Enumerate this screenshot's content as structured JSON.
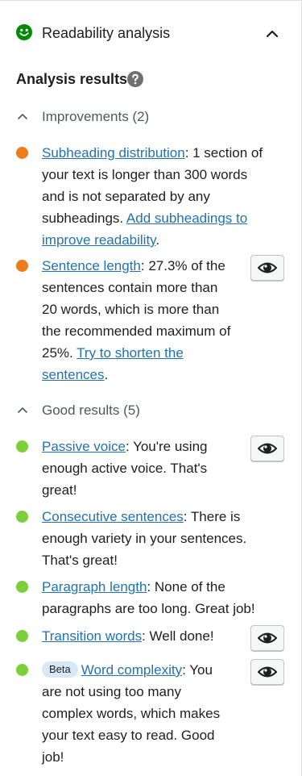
{
  "panel": {
    "title": "Readability analysis"
  },
  "analysis": {
    "title": "Analysis results"
  },
  "groups": {
    "improvements": {
      "label": "Improvements (2)",
      "items": [
        {
          "link": "Subheading distribution",
          "text": ": 1 section of your text is longer than 300 words and is not separated by any subheadings. ",
          "cta": "Add subheadings to improve readability",
          "end": "."
        },
        {
          "link": "Sentence length",
          "text": ": 27.3% of the sentences contain more than 20 words, which is more than the recommended maximum of 25%. ",
          "cta": "Try to shorten the sentences",
          "end": "."
        }
      ]
    },
    "good": {
      "label": "Good results (5)",
      "items": [
        {
          "link": "Passive voice",
          "text": ": You're using enough active voice. That's great!"
        },
        {
          "link": "Consecutive sentences",
          "text": ": There is enough variety in your sentences. That's great!"
        },
        {
          "link": "Paragraph length",
          "text": ": None of the paragraphs are too long. Great job!"
        },
        {
          "link": "Transition words",
          "text": ": Well done!"
        },
        {
          "badge": "Beta",
          "link": "Word complexity",
          "text": ": You are not using too many complex words, which makes your text easy to read. Good job!"
        }
      ]
    }
  },
  "colors": {
    "problem": "#ee7c1b",
    "good": "#7ad03a",
    "link": "#2271b1",
    "smiley": "#008a00"
  },
  "icons": {
    "score": "smiley-icon",
    "collapse": "chevron-up-icon",
    "help": "question-mark-icon",
    "group_toggle": "chevron-up-icon",
    "highlight": "eye-icon"
  }
}
